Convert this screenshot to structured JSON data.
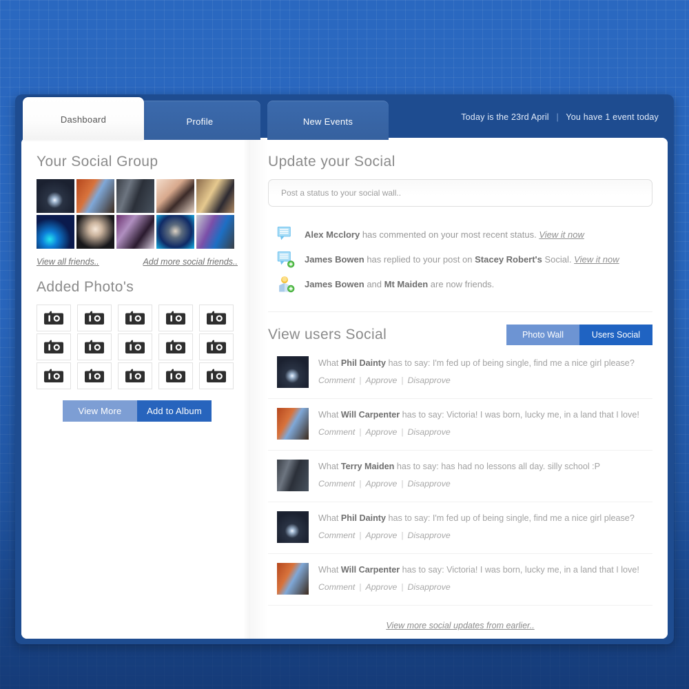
{
  "header": {
    "tabs": [
      {
        "label": "Dashboard",
        "active": true
      },
      {
        "label": "Profile",
        "active": false
      },
      {
        "label": "New Events",
        "active": false
      }
    ],
    "date_text": "Today is the 23rd April",
    "separator": "|",
    "events_text": "You have 1 event today"
  },
  "sidebar": {
    "social_group_title": "Your Social Group",
    "friends": [
      {
        "name": "friend-1"
      },
      {
        "name": "friend-2"
      },
      {
        "name": "friend-3"
      },
      {
        "name": "friend-4"
      },
      {
        "name": "friend-5"
      },
      {
        "name": "friend-6"
      },
      {
        "name": "friend-7"
      },
      {
        "name": "friend-8"
      },
      {
        "name": "friend-9"
      },
      {
        "name": "friend-10"
      }
    ],
    "view_all_friends": "View all friends..",
    "add_more_friends": "Add more social friends..",
    "photos_title": "Added Photo's",
    "photo_count": 15,
    "photo_icon": "camera-icon",
    "view_more_label": "View More",
    "add_album_label": "Add to Album"
  },
  "main": {
    "update_title": "Update your Social",
    "status_placeholder": "Post a status to your social wall..",
    "notifications": [
      {
        "icon": "comment-bubble-icon",
        "actor": "Alex Mcclory",
        "text_after": " has commented on your most recent status. ",
        "target": "",
        "text_tail": "",
        "link": "View it now"
      },
      {
        "icon": "comment-bubble-add-icon",
        "actor": "James Bowen",
        "text_after": " has replied to your post on ",
        "target": "Stacey Robert's",
        "text_tail": " Social. ",
        "link": "View it now"
      },
      {
        "icon": "user-add-icon",
        "actor": "James Bowen",
        "text_after": " and ",
        "target": "Mt Maiden",
        "text_tail": " are now friends.",
        "link": ""
      }
    ],
    "users_social_title": "View users Social",
    "toggles": [
      {
        "label": "Photo Wall",
        "active": false
      },
      {
        "label": "Users Social",
        "active": true
      }
    ],
    "posts": [
      {
        "prefix": "What ",
        "author": "Phil Dainty",
        "middle": " has to say:  ",
        "message": "I'm fed up of being single, find me a nice girl please?",
        "actions": [
          "Comment",
          "Approve",
          "Disapprove"
        ],
        "avatar": "avatar-phil-dainty"
      },
      {
        "prefix": "What ",
        "author": "Will Carpenter",
        "middle": " has to say:  ",
        "message": "Victoria! I was born, lucky me, in a land that I love!",
        "actions": [
          "Comment",
          "Approve",
          "Disapprove"
        ],
        "avatar": "avatar-will-carpenter"
      },
      {
        "prefix": "What ",
        "author": "Terry Maiden",
        "middle": " has to say:  ",
        "message": "has had no lessons all day. silly school :P",
        "actions": [
          "Comment",
          "Approve",
          "Disapprove"
        ],
        "avatar": "avatar-terry-maiden"
      },
      {
        "prefix": "What ",
        "author": "Phil Dainty",
        "middle": " has to say:  ",
        "message": "I'm fed up of being single, find me a nice girl please?",
        "actions": [
          "Comment",
          "Approve",
          "Disapprove"
        ],
        "avatar": "avatar-phil-dainty"
      },
      {
        "prefix": "What ",
        "author": "Will Carpenter",
        "middle": " has to say:  ",
        "message": "Victoria! I was born, lucky me, in a land that I love!",
        "actions": [
          "Comment",
          "Approve",
          "Disapprove"
        ],
        "avatar": "avatar-will-carpenter"
      }
    ],
    "view_more_updates": "View more social updates from earlier.."
  },
  "colors": {
    "background_blue": "#2a68c0",
    "window_blue": "#1e4c90",
    "tab_inactive": "#3b6aad",
    "accent_blue": "#2764bd",
    "accent_light_blue": "#7d9ed4",
    "toggle_on": "#1f63c2",
    "toggle_off": "#6d94d3",
    "text_gray": "#8a8a8a"
  }
}
